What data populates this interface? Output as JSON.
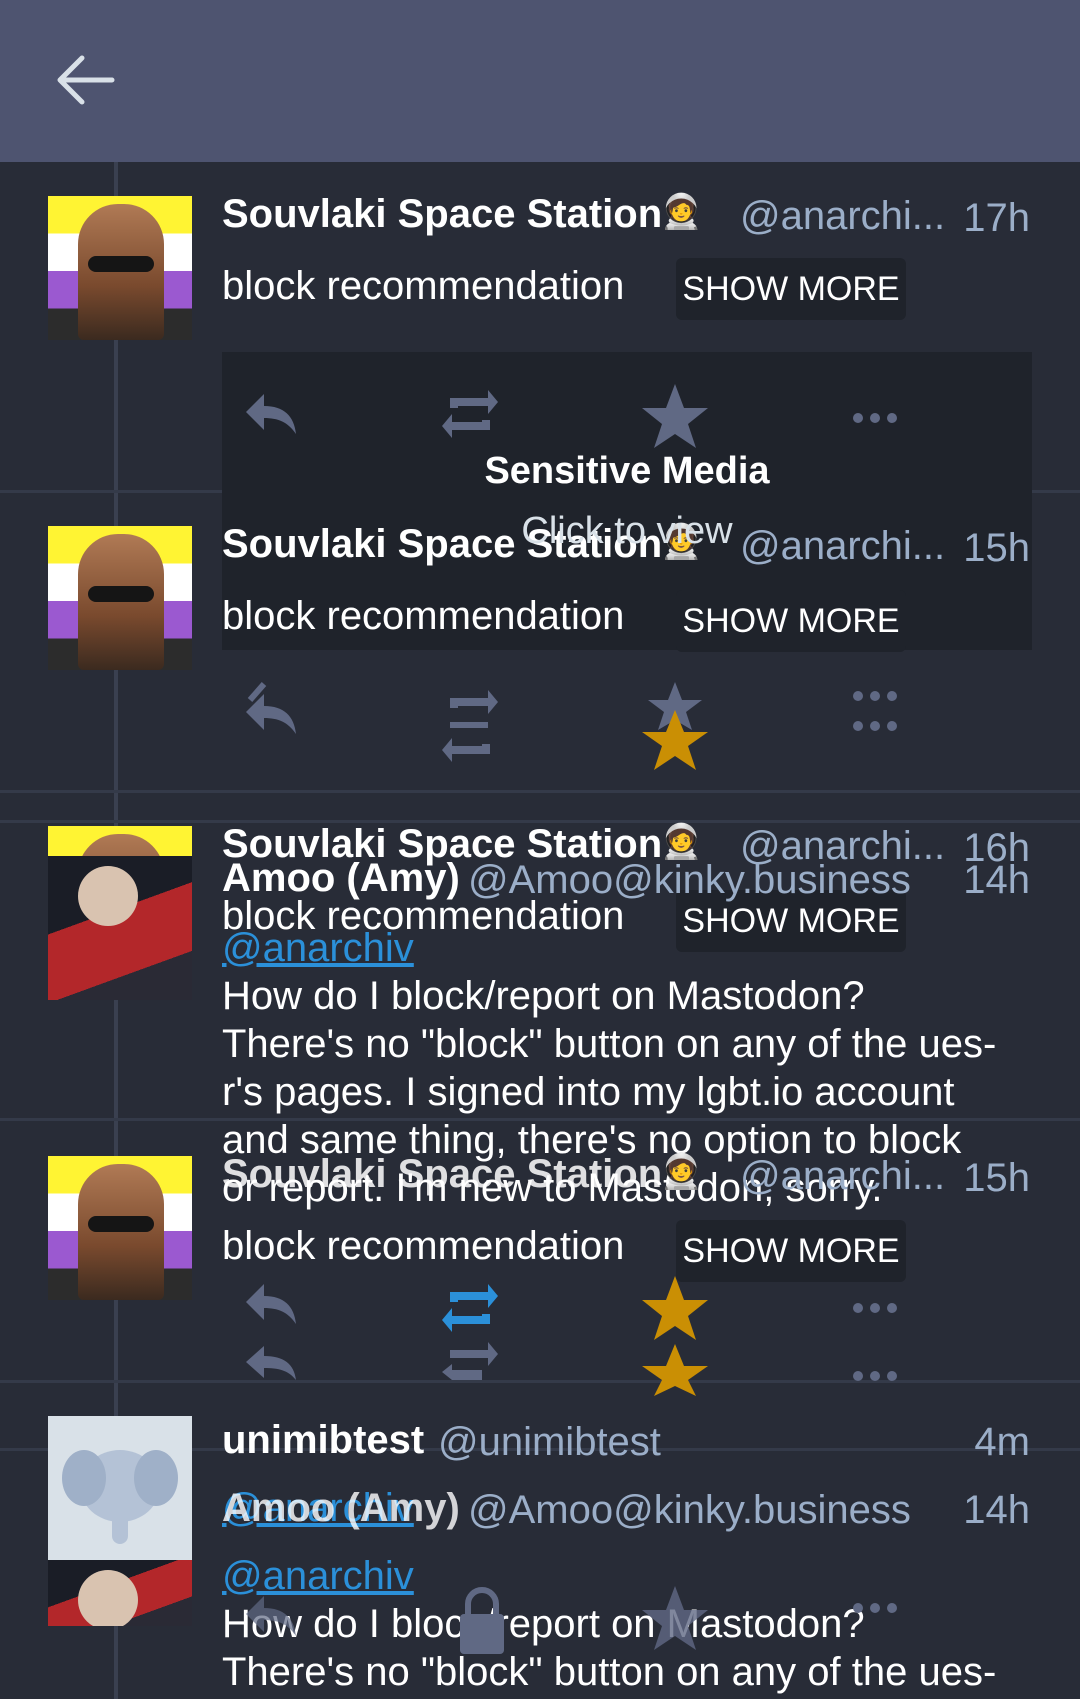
{
  "header": {
    "back_icon": "arrow-left-icon"
  },
  "status_a": {
    "name": "Souvlaki Space Station",
    "handle": "@anarchi...",
    "time": "17h",
    "time_alt": "16h",
    "body": "block recommendation",
    "show_more": "SHOW MORE"
  },
  "sensitive": {
    "title": "Sensitive Media",
    "subtitle": "Click to view"
  },
  "status_b": {
    "name": "Souvlaki Space Station",
    "handle": "@anarchi...",
    "time": "15h",
    "body": "block recommendation",
    "show_more": "SHOW MORE"
  },
  "status_c": {
    "name": "Souvlaki Space Station",
    "handle": "@anarchi...",
    "time": "16h",
    "body": "block recommendation",
    "show_more": "SHOW MORE"
  },
  "status_amy": {
    "name": "Amoo (Amy)",
    "handle": "@Amoo@kinky.business",
    "time": "14h",
    "mention": "@anarchiv",
    "lines": [
      "How do I block/report on Mastodon?",
      "There's no \"block\" button on any of the ues-",
      "r's pages. I signed into my lgbt.io account",
      "and same thing, there's no option to block",
      "or report. I'm new to Mastodon, sorry."
    ]
  },
  "status_d": {
    "name": "Souvlaki Space Station",
    "handle": "@anarchi...",
    "time": "15h",
    "body": "block recommendation",
    "show_more": "SHOW MORE"
  },
  "status_e": {
    "name": "unimibtest",
    "handle": "@unimibtest",
    "time": "4m"
  },
  "status_amy2": {
    "name": "Amoo (Amy)",
    "handle": "@Amoo@kinky.business",
    "time": "14h",
    "mention": "@anarchiv",
    "mention_top": "@anarchiv",
    "lines": [
      "How do I block/report on Mastodon?",
      "There's no \"block\" button on any of the ues-"
    ]
  },
  "colors": {
    "accent": "#2b90d9",
    "favourite": "#ca8f04",
    "icon": "#606984"
  }
}
